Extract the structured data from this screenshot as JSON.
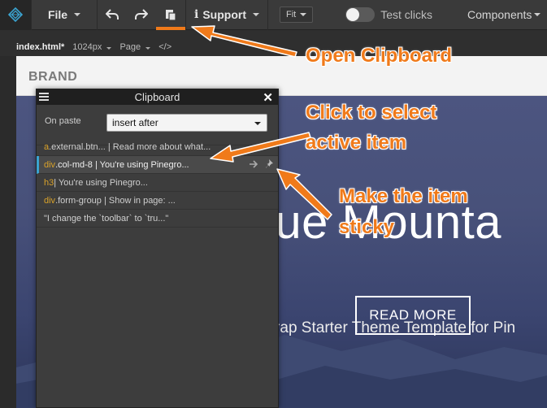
{
  "toolbar": {
    "file_label": "File",
    "support_label": "Support",
    "fit_label": "Fit",
    "test_clicks_label": "Test clicks",
    "components_label": "Components"
  },
  "subbar": {
    "file_name": "index.html*",
    "width_label": "1024px",
    "page_label": "Page",
    "code_label": "</>"
  },
  "site": {
    "brand": "BRAND",
    "hero_title": "lue Mounta",
    "hero_subtitle": "tstrap Starter Theme Template for Pin",
    "read_more": "READ MORE"
  },
  "clipboard": {
    "title": "Clipboard",
    "on_paste_label": "On paste",
    "paste_option": "insert after",
    "items": [
      {
        "tag": "a",
        "text": ".external.btn... | Read more about what..."
      },
      {
        "tag": "div",
        "text": ".col-md-8 | You're using Pinegro..."
      },
      {
        "tag": "h3",
        "text": " | You're using Pinegro..."
      },
      {
        "tag": "div",
        "text": ".form-group | Show in page: ..."
      },
      {
        "tag": "",
        "text": "\"I change the `toolbar` to `tru...\""
      }
    ]
  },
  "annotations": {
    "open_clipboard": "Open Clipboard",
    "select_line1": "Click to select",
    "select_line2": "active item",
    "sticky_line1": "Make the item",
    "sticky_line2": "sticky"
  },
  "colors": {
    "accent": "#f07a1a",
    "active_border": "#3ba3d0",
    "tag_color": "#d9a22a"
  }
}
